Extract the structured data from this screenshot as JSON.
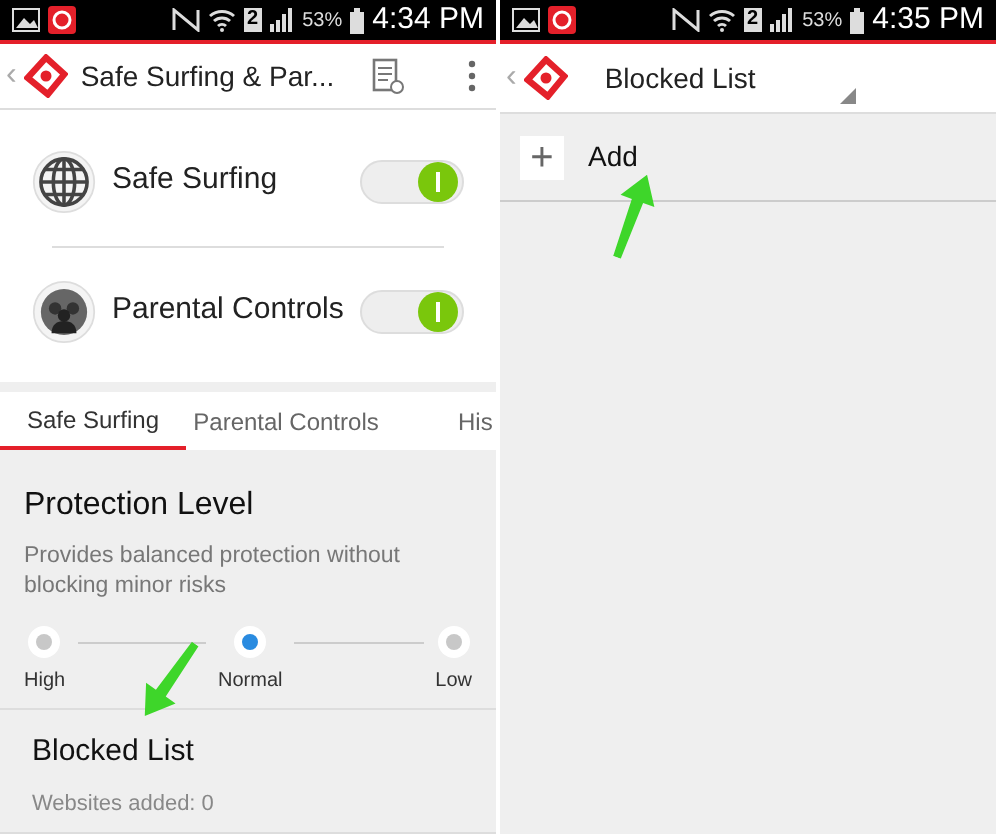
{
  "screens": [
    {
      "status_bar": {
        "sim": "2",
        "battery": "53%",
        "time": "4:34 PM"
      },
      "app_bar": {
        "back": "‹",
        "title": "Safe Surfing & Par...",
        "dropdown": false
      },
      "switches": [
        {
          "label": "Safe Surfing",
          "kind": "globe",
          "on": true
        },
        {
          "label": "Parental Controls",
          "kind": "people",
          "on": true
        }
      ],
      "tabs": [
        {
          "label": "Safe Surfing",
          "selected": true
        },
        {
          "label": "Parental Controls",
          "selected": false
        },
        {
          "label": "His",
          "selected": false
        }
      ],
      "protection": {
        "title": "Protection Level",
        "description": "Provides balanced protection without blocking minor risks",
        "levels": [
          {
            "label": "High",
            "selected": false
          },
          {
            "label": "Normal",
            "selected": true
          },
          {
            "label": "Low",
            "selected": false
          }
        ]
      },
      "blocked_list": {
        "title": "Blocked List",
        "subtitle": "Websites added: 0"
      }
    },
    {
      "status_bar": {
        "sim": "2",
        "battery": "53%",
        "time": "4:35 PM"
      },
      "app_bar": {
        "back": "‹",
        "title": "Blocked List",
        "dropdown": true
      },
      "add_button": {
        "icon": "+",
        "label": "Add"
      }
    }
  ]
}
